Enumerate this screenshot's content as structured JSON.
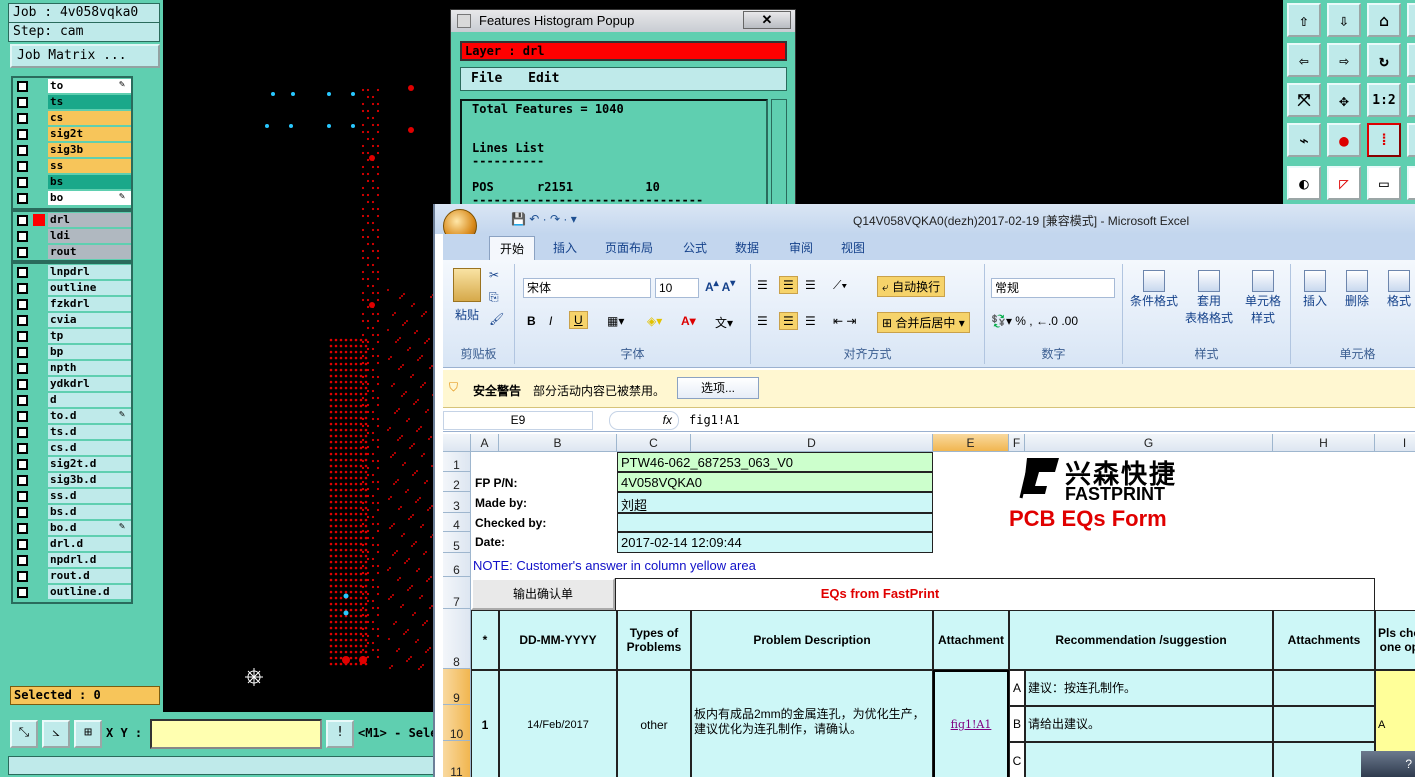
{
  "left_panel": {
    "job": "Job : 4v058vqka0",
    "step": "Step: cam",
    "job_matrix": "Job Matrix ...",
    "layers_board": [
      {
        "name": "to",
        "color": "#ffffff",
        "pen": true
      },
      {
        "name": "ts",
        "color": "#1aa88a"
      },
      {
        "name": "cs",
        "color": "#f7c55a"
      },
      {
        "name": "sig2t",
        "color": "#f7c55a"
      },
      {
        "name": "sig3b",
        "color": "#f7c55a"
      },
      {
        "name": "ss",
        "color": "#f7c55a"
      },
      {
        "name": "bs",
        "color": "#1aa88a"
      },
      {
        "name": "bo",
        "color": "#ffffff",
        "pen": true
      }
    ],
    "layers_drill": [
      {
        "name": "drl",
        "color": "#b0b8c0",
        "active": true
      },
      {
        "name": "ldi",
        "color": "#b0b8c0"
      },
      {
        "name": "rout",
        "color": "#b0b8c0"
      }
    ],
    "layers_misc": [
      {
        "name": "lnpdrl"
      },
      {
        "name": "outline"
      },
      {
        "name": "fzkdrl"
      },
      {
        "name": "cvia"
      },
      {
        "name": "tp"
      },
      {
        "name": "bp"
      },
      {
        "name": "npth"
      },
      {
        "name": "ydkdrl"
      },
      {
        "name": "d"
      },
      {
        "name": "to.d",
        "pen": true
      },
      {
        "name": "ts.d"
      },
      {
        "name": "cs.d"
      },
      {
        "name": "sig2t.d"
      },
      {
        "name": "sig3b.d"
      },
      {
        "name": "ss.d"
      },
      {
        "name": "bs.d"
      },
      {
        "name": "bo.d",
        "pen": true
      },
      {
        "name": "drl.d"
      },
      {
        "name": "npdrl.d"
      },
      {
        "name": "rout.d"
      },
      {
        "name": "outline.d"
      }
    ],
    "selected": "Selected : 0"
  },
  "bottom_bar": {
    "xy_label": "X Y :",
    "xy_value": "",
    "mode_text": "<M1> - Sele"
  },
  "histogram": {
    "title": "Features Histogram Popup",
    "close": "✕",
    "layer": "Layer :  drl",
    "menu": [
      "File",
      "Edit"
    ],
    "text": "Total Features = 1040\n\n\nLines List\n----------\n\nPOS      r2151          10\n--------------------------------"
  },
  "excel": {
    "title": "Q14V058VQKA0(dezh)2017-02-19  [兼容模式] - Microsoft Excel",
    "tabs": [
      "开始",
      "插入",
      "页面布局",
      "公式",
      "数据",
      "审阅",
      "视图"
    ],
    "ribbon": {
      "paste": "粘贴",
      "clipboard": "剪贴板",
      "font_name": "宋体",
      "font_size": "10",
      "font_group": "字体",
      "wrap": "自动换行",
      "merge": "合并后居中",
      "align_group": "对齐方式",
      "number_format": "常规",
      "number_group": "数字",
      "cond_format": "条件格式",
      "table_format": "套用\n表格格式",
      "cell_style": "单元格\n样式",
      "style_group": "样式",
      "insert": "插入",
      "delete": "删除",
      "format": "格式",
      "cells_group": "单元格"
    },
    "security": {
      "label": "安全警告",
      "message": "部分活动内容已被禁用。",
      "button": "选项..."
    },
    "name_box": "E9",
    "formula": "fig1!A1",
    "columns": [
      "A",
      "B",
      "C",
      "D",
      "E",
      "F",
      "G",
      "H",
      "I"
    ],
    "rows": [
      "1",
      "2",
      "3",
      "4",
      "5",
      "6",
      "7",
      "8",
      "9",
      "10",
      "11"
    ],
    "sheet": {
      "c1": "PTW46-062_687253_063_V0",
      "b2": "FP P/N:",
      "c2": "4V058VQKA0",
      "b3": "Made by:",
      "c3": "刘超",
      "b4": "Checked by:",
      "c4": "",
      "b5": "Date:",
      "c5": "2017-02-14 12:09:44",
      "note": "NOTE: Customer's  answer in column yellow area",
      "logo_cn": "兴森快捷",
      "logo_en": "FASTPRINT",
      "form_title": "PCB EQs Form",
      "export_btn": "输出确认单",
      "eq_header": "EQs from FastPrint",
      "h_star": "*",
      "h_date": "DD-MM-YYYY",
      "h_types": "Types of\nProblems",
      "h_desc": "Problem Description",
      "h_attach": "Attachment",
      "h_rec": "Recommendation /suggestion",
      "h_attachs": "Attachments",
      "h_pls": "Pls cho\none op",
      "r_num": "1",
      "r_date": "14/Feb/2017",
      "r_type": "other",
      "r_desc": "板内有成品2mm的金属连孔，为优化生产，\n建议优化为连孔制作，请确认。",
      "r_link": "fig1!A1",
      "opt_a": "A",
      "opt_a_text": "建议：按连孔制作。",
      "opt_b": "B",
      "opt_b_text": "请给出建议。",
      "opt_c": "C",
      "pls_val": "A"
    }
  }
}
